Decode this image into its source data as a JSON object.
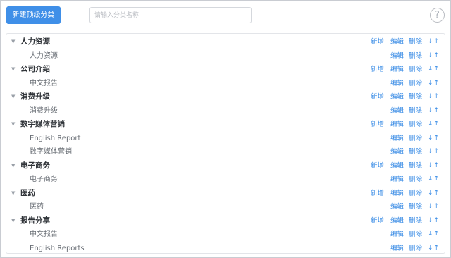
{
  "toolbar": {
    "new_top_label": "新建顶级分类",
    "search_placeholder": "请输入分类名称",
    "help_glyph": "?"
  },
  "actions": {
    "add": "新增",
    "edit": "编辑",
    "delete": "删除",
    "move_down": "↓",
    "move_up": "↑"
  },
  "tree": [
    {
      "name": "人力资源",
      "children": [
        "人力资源"
      ]
    },
    {
      "name": "公司介绍",
      "children": [
        "中文报告"
      ]
    },
    {
      "name": "消费升级",
      "children": [
        "消费升级"
      ]
    },
    {
      "name": "数字媒体营销",
      "children": [
        "English Report",
        "数字媒体营销"
      ]
    },
    {
      "name": "电子商务",
      "children": [
        "电子商务"
      ]
    },
    {
      "name": "医药",
      "children": [
        "医药"
      ]
    },
    {
      "name": "报告分享",
      "children": [
        "中文报告",
        "English Reports"
      ]
    }
  ]
}
